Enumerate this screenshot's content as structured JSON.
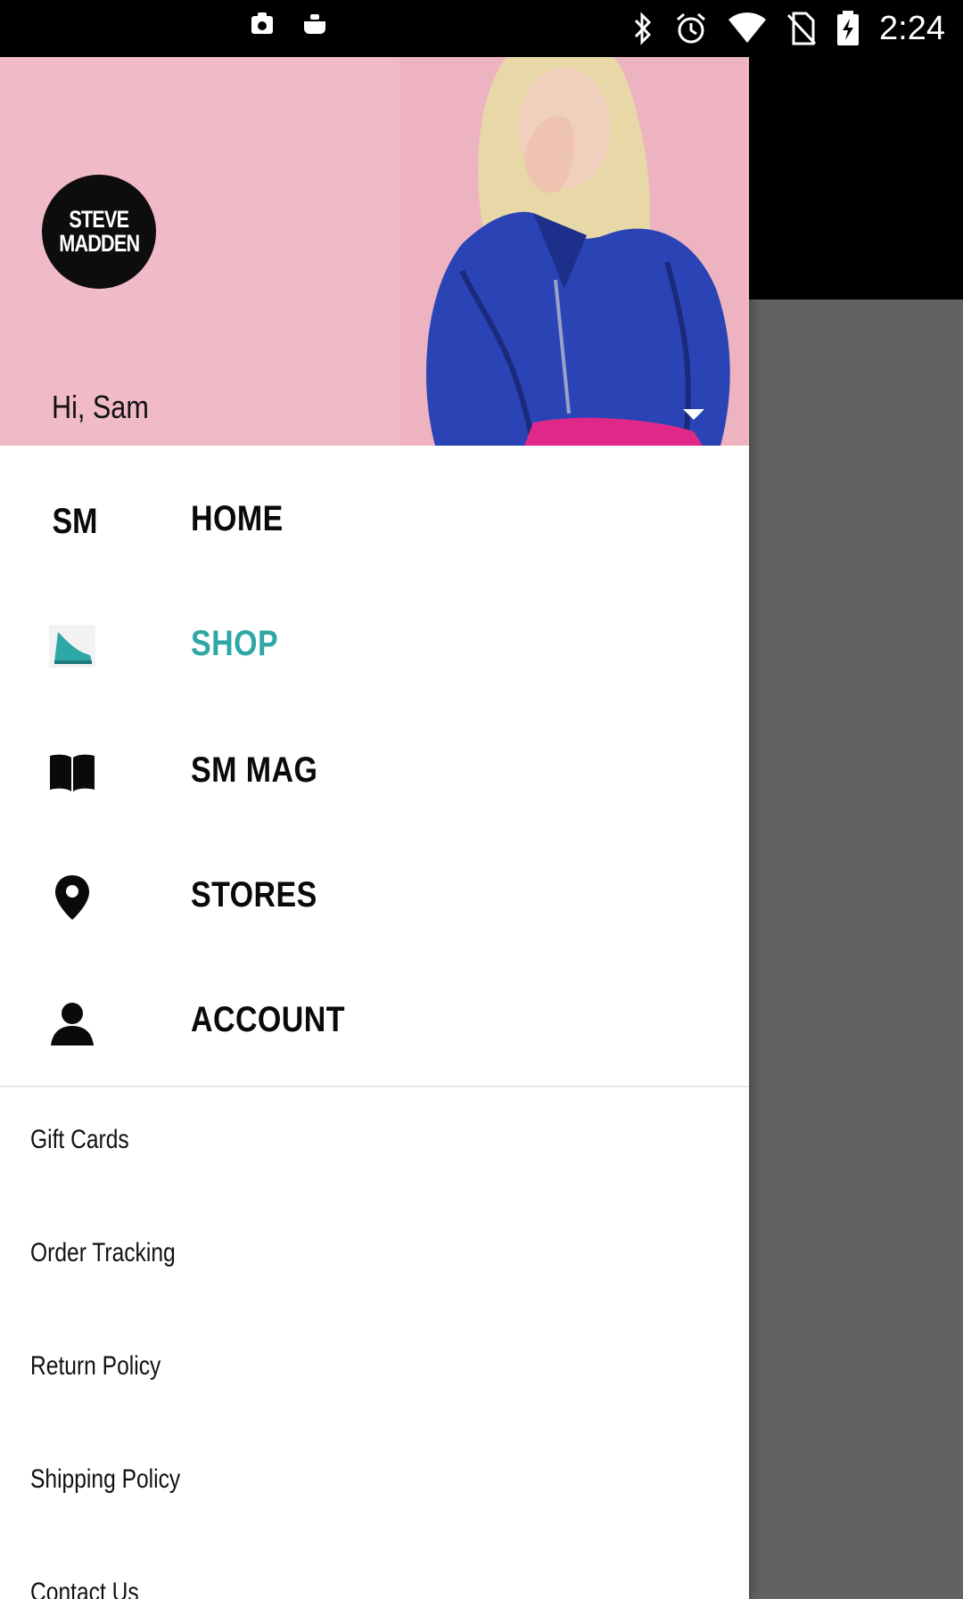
{
  "status_bar": {
    "time": "2:24",
    "icons": [
      "notification-icon",
      "notification-icon",
      "bluetooth-icon",
      "alarm-icon",
      "wifi-icon",
      "no-sim-icon",
      "battery-charging-icon"
    ]
  },
  "drawer": {
    "brand_logo": {
      "line1": "STEVE",
      "line2": "MADDEN"
    },
    "greeting": "Hi, Sam",
    "primary_nav": [
      {
        "label": "HOME",
        "icon": "sm-logo-text",
        "icon_text": "SM",
        "active": false
      },
      {
        "label": "SHOP",
        "icon": "shoe-icon",
        "active": true
      },
      {
        "label": "SM MAG",
        "icon": "book-icon",
        "active": false
      },
      {
        "label": "STORES",
        "icon": "location-pin-icon",
        "active": false
      },
      {
        "label": "ACCOUNT",
        "icon": "person-icon",
        "active": false
      }
    ],
    "secondary_nav": [
      {
        "label": "Gift Cards"
      },
      {
        "label": "Order Tracking"
      },
      {
        "label": "Return Policy"
      },
      {
        "label": "Shipping Policy"
      },
      {
        "label": "Contact Us"
      }
    ]
  },
  "colors": {
    "header_bg": "#f0bac8",
    "active_nav": "#2ea8a6",
    "scrim": "#626265"
  }
}
